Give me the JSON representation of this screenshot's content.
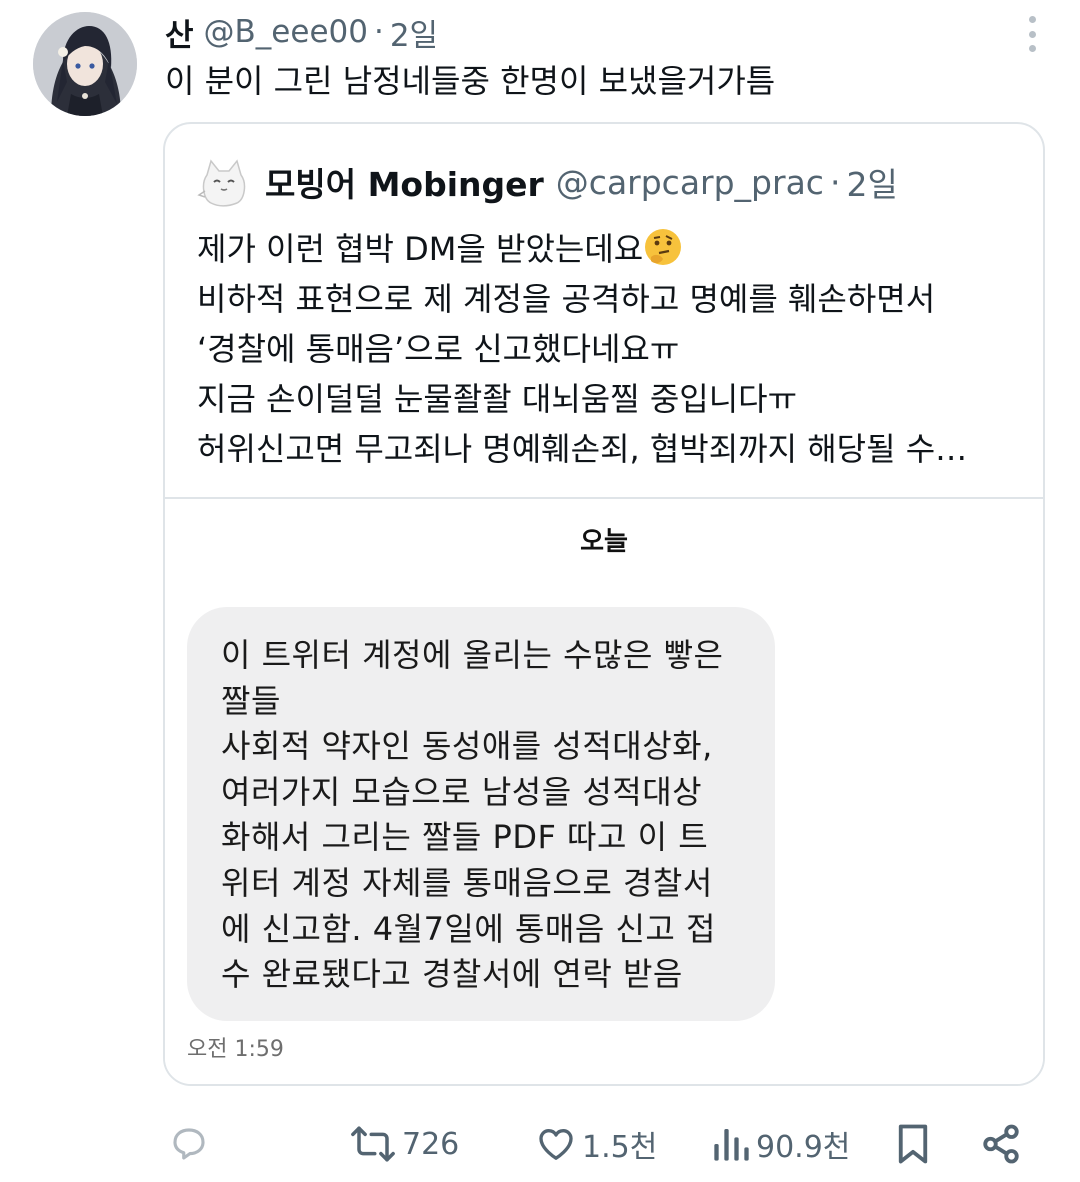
{
  "tweet": {
    "author_name": "산",
    "author_handle": "@B_eee00",
    "separator": "·",
    "time": "2일",
    "text": "이 분이 그린 남정네들중 한명이 보냈을거가틈"
  },
  "quoted_tweet": {
    "author_name": "모빙어 Mobinger",
    "author_handle": "@carpcarp_prac",
    "separator": "·",
    "time": "2일",
    "lines": [
      "제가 이런 협박 DM을 받았는데요",
      "비하적 표현으로 제 계정을 공격하고 명예를 훼손하면서",
      "‘경찰에 통매음’으로 신고했다네요ㅠ",
      "지금 손이덜덜 눈물좔좔 대뇌움찔 중입니다ㅠ",
      "허위신고면 무고죄나 명예훼손죄, 협박죄까지 해당될 수…"
    ],
    "emoji_icon": "thinking-face-emoji"
  },
  "dm_screenshot": {
    "date_label": "오늘",
    "message_lines": [
      "이 트위터 계정에 올리는 수많은 빻은",
      "짤들",
      "사회적 약자인 동성애를 성적대상화,",
      "여러가지 모습으로 남성을 성적대상",
      "화해서 그리는 짤들 PDF 따고 이 트",
      "위터 계정 자체를 통매음으로 경찰서",
      "에 신고함. 4월7일에 통매음 신고 접",
      "수 완료됐다고 경찰서에 연락 받음"
    ],
    "message_time": "오전 1:59"
  },
  "actions": {
    "reply_count": "",
    "retweet_count": "726",
    "like_count": "1.5천",
    "views_count": "90.9천"
  },
  "colors": {
    "text_primary": "#0f1419",
    "text_secondary": "#536471",
    "border": "#dfe4e8",
    "dm_bubble": "#efeff0"
  }
}
